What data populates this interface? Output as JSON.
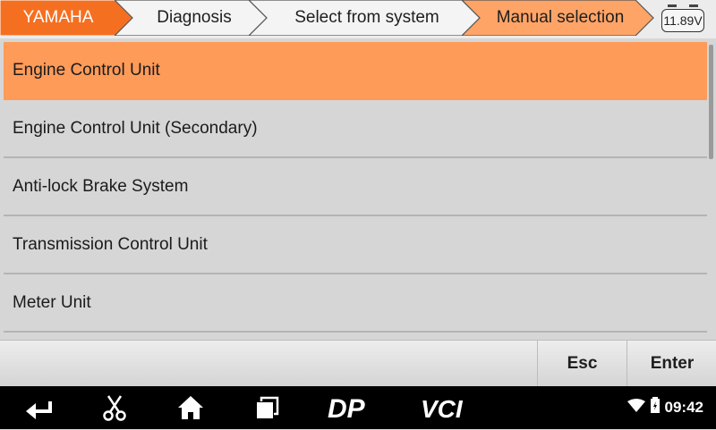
{
  "breadcrumb": {
    "items": [
      {
        "label": "YAMAHA"
      },
      {
        "label": "Diagnosis"
      },
      {
        "label": "Select from system"
      },
      {
        "label": "Manual selection"
      }
    ],
    "battery_voltage": "11.89V"
  },
  "list": {
    "items": [
      {
        "label": "Engine Control Unit",
        "selected": true
      },
      {
        "label": "Engine Control Unit (Secondary)"
      },
      {
        "label": "Anti-lock Brake System"
      },
      {
        "label": "Transmission Control Unit"
      },
      {
        "label": "Meter Unit"
      }
    ]
  },
  "actions": {
    "esc_label": "Esc",
    "enter_label": "Enter"
  },
  "navbar": {
    "icons": [
      "back-icon",
      "scissors-icon",
      "home-icon",
      "recent-apps-icon",
      "dp-icon",
      "vci-icon"
    ],
    "dp_label": "DP",
    "vci_label": "VCI"
  },
  "status": {
    "time": "09:42",
    "icons": [
      "wifi-icon",
      "battery-icon"
    ]
  },
  "colors": {
    "accent": "#ff9b59",
    "crumb_first": "#f56f21",
    "crumb_other": "#f4f4f4"
  }
}
